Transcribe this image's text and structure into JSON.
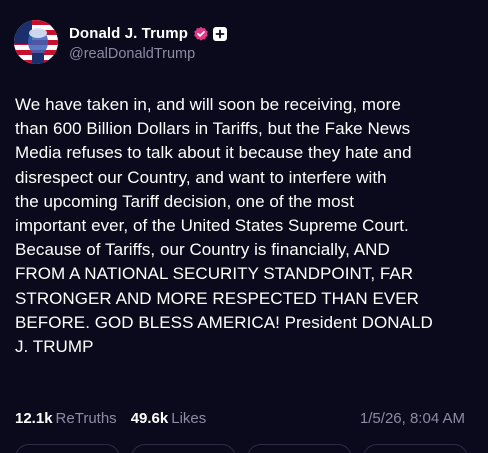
{
  "post": {
    "author": {
      "display_name": "Donald J. Trump",
      "handle": "@realDonaldTrump",
      "verified_icon": "verified-badge-icon",
      "plus_icon": "plus-icon"
    },
    "text": "We have taken in, and will soon be receiving, more\nthan 600 Billion Dollars in Tariffs, but the Fake News\nMedia refuses to talk about it because they hate and\ndisrespect our Country, and want to interfere with\nthe upcoming Tariff decision, one of the most\nimportant ever, of the United States Supreme Court.\nBecause of Tariffs, our Country is financially, AND\nFROM A NATIONAL SECURITY STANDPOINT, FAR\nSTRONGER AND MORE RESPECTED THAN EVER\nBEFORE. GOD BLESS AMERICA! President DONALD\nJ. TRUMP",
    "stats": {
      "retruths_count": "12.1k",
      "retruths_label": "ReTruths",
      "likes_count": "49.6k",
      "likes_label": "Likes"
    },
    "timestamp": "1/5/26, 8:04 AM"
  },
  "colors": {
    "background": "#0b0a1c",
    "text_primary": "#ffffff",
    "text_secondary": "#8d8aa3",
    "verified_badge": "#e0398a"
  }
}
